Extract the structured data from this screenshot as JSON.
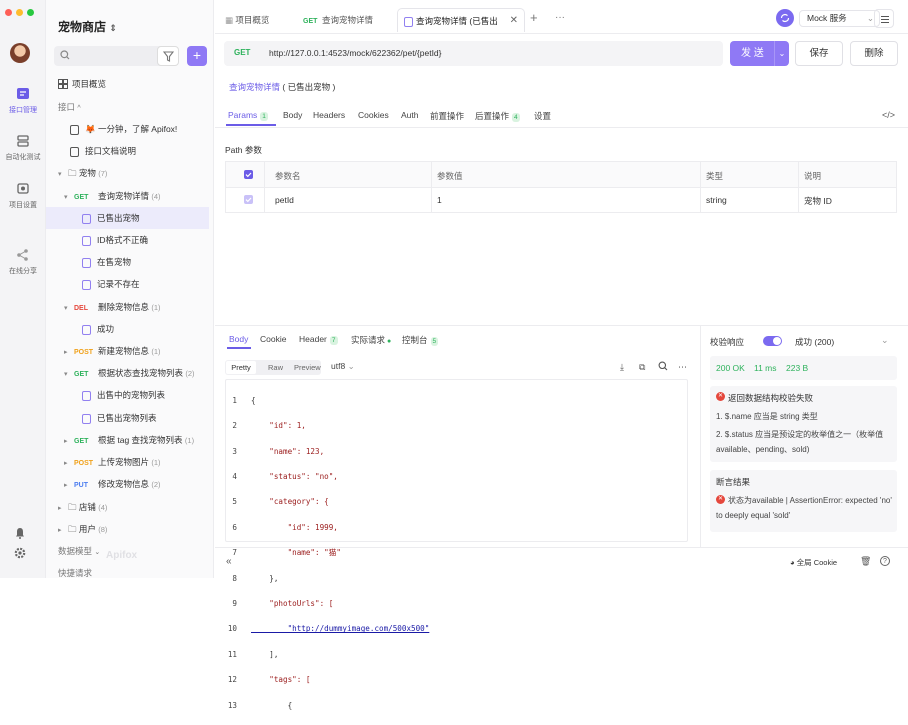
{
  "rail": {
    "items": [
      {
        "icon": "api-icon",
        "label": "接口管理"
      },
      {
        "icon": "auto-test-icon",
        "label": "自动化测试"
      },
      {
        "icon": "settings-icon",
        "label": "项目设置"
      },
      {
        "icon": "share-icon",
        "label": "在线分享"
      }
    ]
  },
  "tree": {
    "store_name": "宠物商店",
    "search_placeholder": "",
    "overview": "项目概览",
    "section_api": "接口",
    "rows": [
      {
        "label": "🦊 一分钟，了解 Apifox!"
      },
      {
        "label": "接口文档说明"
      },
      {
        "label": "宠物",
        "count": "(7)"
      },
      {
        "method": "GET",
        "label": "查询宠物详情",
        "count": "(4)"
      },
      {
        "label": "已售出宠物"
      },
      {
        "label": "ID格式不正确"
      },
      {
        "label": "在售宠物"
      },
      {
        "label": "记录不存在"
      },
      {
        "method": "DEL",
        "label": "删除宠物信息",
        "count": "(1)"
      },
      {
        "label": "成功"
      },
      {
        "method": "POST",
        "label": "新建宠物信息",
        "count": "(1)"
      },
      {
        "method": "GET",
        "label": "根据状态查找宠物列表",
        "count": "(2)"
      },
      {
        "label": "出售中的宠物列表"
      },
      {
        "label": "已售出宠物列表"
      },
      {
        "method": "GET",
        "label": "根据 tag 查找宠物列表",
        "count": "(1)"
      },
      {
        "method": "POST",
        "label": "上传宠物图片",
        "count": "(1)"
      },
      {
        "method": "PUT",
        "label": "修改宠物信息",
        "count": "(2)"
      },
      {
        "label": "店铺",
        "count": "(4)"
      },
      {
        "label": "用户",
        "count": "(8)"
      }
    ],
    "data_model": "数据模型",
    "quick_request": "快捷请求",
    "watermark": "Apifox"
  },
  "tabs": [
    {
      "label": "项目概览"
    },
    {
      "method": "GET",
      "label": "查询宠物详情"
    },
    {
      "label": "查询宠物详情 (已售出"
    }
  ],
  "env": {
    "label": "Mock 服务"
  },
  "request": {
    "method": "GET",
    "url": "http://127.0.0.1:4523/mock/622362/pet/{petId}",
    "send": "发 送",
    "save": "保存",
    "delete": "删除",
    "crumb_link": "查询宠物详情",
    "crumb_rest": "( 已售出宠物 )"
  },
  "req_tabs": [
    {
      "label": "Params",
      "badge": "1"
    },
    {
      "label": "Body"
    },
    {
      "label": "Headers"
    },
    {
      "label": "Cookies"
    },
    {
      "label": "Auth"
    },
    {
      "label": "前置操作"
    },
    {
      "label": "后置操作",
      "badge": "4"
    },
    {
      "label": "设置"
    }
  ],
  "path_params": {
    "title": "Path 参数",
    "headers": [
      "参数名",
      "参数值",
      "类型",
      "说明"
    ],
    "rows": [
      {
        "name": "petId",
        "value": "1",
        "type": "string",
        "desc": "宠物 ID"
      }
    ]
  },
  "resp_tabs": [
    {
      "label": "Body"
    },
    {
      "label": "Cookie"
    },
    {
      "label": "Header",
      "badge": "7"
    },
    {
      "label": "实际请求"
    },
    {
      "label": "控制台",
      "badge": "5"
    }
  ],
  "format": {
    "options": [
      "Pretty",
      "Raw",
      "Preview"
    ],
    "encoding": "utf8"
  },
  "code_lines": [
    "{",
    "    \"id\": 1,",
    "    \"name\": 123,",
    "    \"status\": \"no\",",
    "    \"category\": {",
    "        \"id\": 1999,",
    "        \"name\": \"猫\"",
    "    },",
    "    \"photoUrls\": [",
    "        \"http://dummyimage.com/500x500\"",
    "    ],",
    "    \"tags\": [",
    "        {"
  ],
  "validation": {
    "label": "校验响应",
    "result": "成功 (200)",
    "status": "200 OK",
    "time": "11 ms",
    "size": "223 B",
    "error_title": "返回数据结构校验失败",
    "errors": [
      "1. $.name 应当是 string 类型",
      "2. $.status 应当是预设定的枚举值之一（枚举值 available、pending、sold)"
    ],
    "assert_title": "断言结果",
    "assert_text": "状态为available | AssertionError: expected 'no' to deeply equal 'sold'"
  },
  "footer": {
    "cookie": "全局 Cookie"
  }
}
